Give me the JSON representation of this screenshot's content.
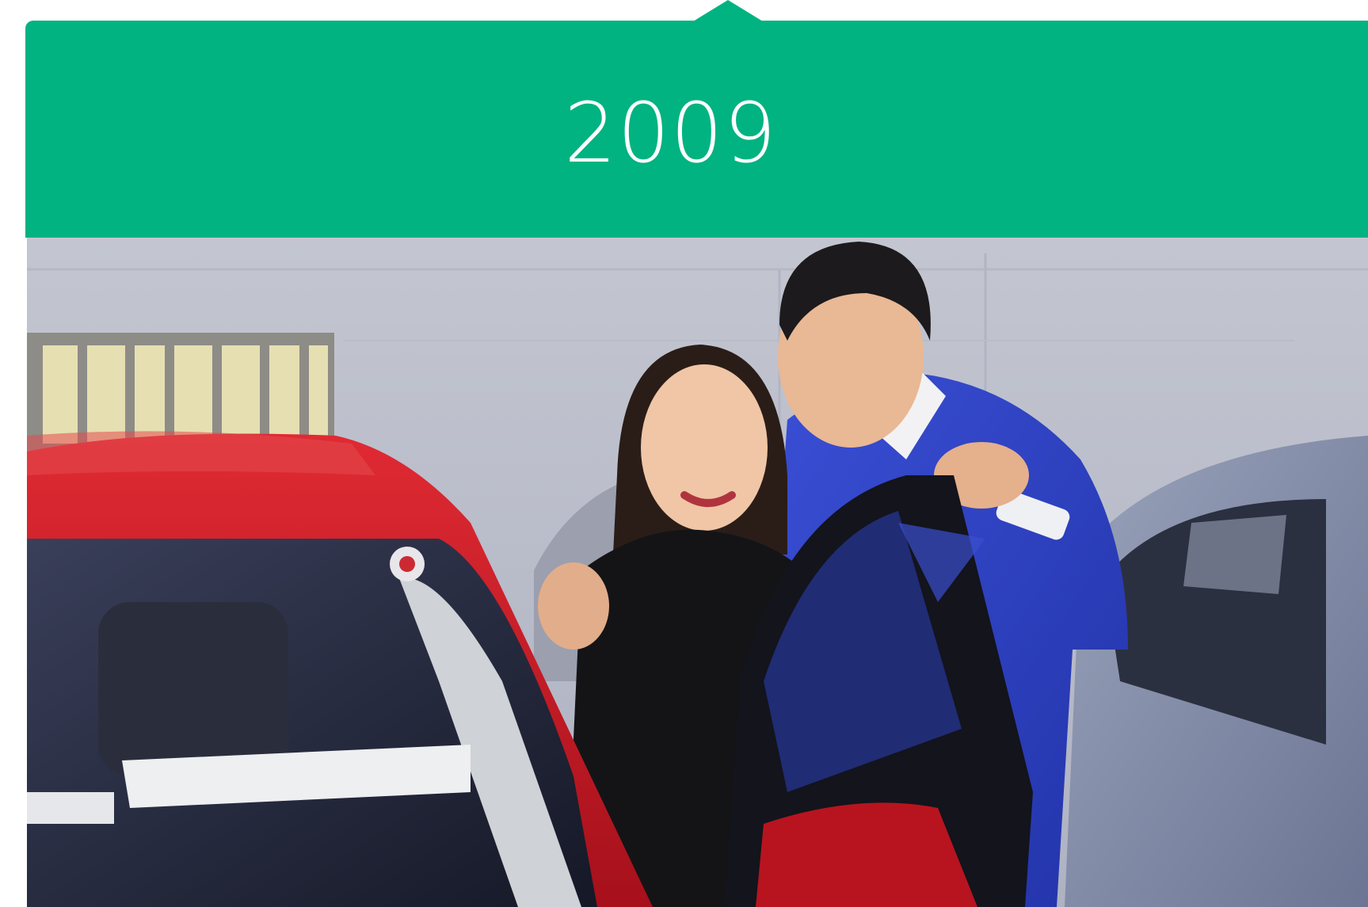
{
  "timeline": {
    "year": "2009",
    "accent_color": "#00b381"
  },
  "photo": {
    "icon": "photo-couple-with-car"
  }
}
